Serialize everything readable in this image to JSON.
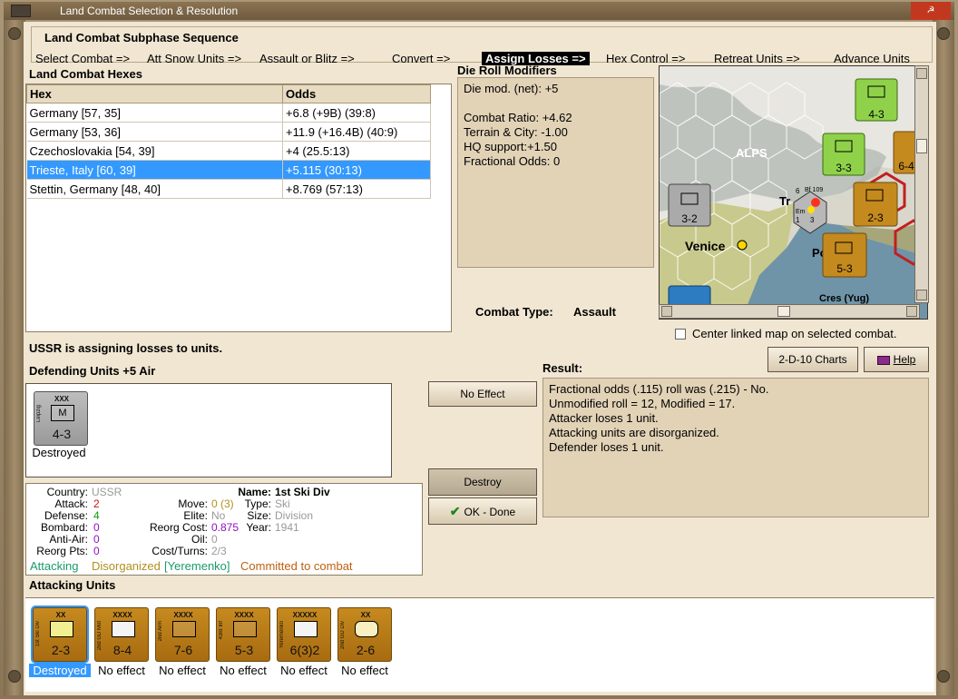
{
  "window": {
    "title": "Land Combat Selection & Resolution"
  },
  "sequence": {
    "title": "Land Combat Subphase Sequence",
    "steps": [
      "Select Combat =>",
      "Att Snow Units =>",
      "Assault or Blitz =>",
      "Convert =>",
      "Assign Losses =>",
      "Hex Control =>",
      "Retreat Units =>",
      "Advance Units"
    ],
    "active_index": 4
  },
  "hexes": {
    "title": "Land Combat Hexes",
    "columns": [
      "Hex",
      "Odds"
    ],
    "rows": [
      {
        "hex": "Germany [57, 35]",
        "odds": "+6.8 (+9B) (39:8)"
      },
      {
        "hex": "Germany [53, 36]",
        "odds": "+11.9 (+16.4B) (40:9)"
      },
      {
        "hex": "Czechoslovakia [54, 39]",
        "odds": "+4 (25.5:13)"
      },
      {
        "hex": "Trieste, Italy [60, 39]",
        "odds": "+5.115 (30:13)"
      },
      {
        "hex": "Stettin, Germany [48, 40]",
        "odds": "+8.769 (57:13)"
      }
    ],
    "selected_index": 3
  },
  "die_roll": {
    "title": "Die Roll Modifiers",
    "lines": [
      "Die mod. (net): +5",
      "",
      "Combat Ratio: +4.62",
      "Terrain & City: -1.00",
      "HQ support:+1.50",
      "Fractional Odds: 0"
    ]
  },
  "map": {
    "labels": {
      "alps": "ALPS",
      "venice": "Venice",
      "cres": "Cres (Yug)",
      "tr": "Tr",
      "po": "Po",
      "bf": "Bf 109",
      "em": "Em",
      "six": "6",
      "one": "1",
      "three": "3"
    },
    "units": [
      {
        "str": "4-3",
        "size": "XXX",
        "color": "green"
      },
      {
        "str": "3-3",
        "size": "XXX",
        "color": "green"
      },
      {
        "str": "3-2",
        "size": "XXX",
        "color": "gray"
      },
      {
        "str": "2-3",
        "size": "XX",
        "color": "orange"
      },
      {
        "str": "5-3",
        "size": "XXXX",
        "color": "orange"
      },
      {
        "str": "6-4",
        "size": "",
        "color": "orange"
      }
    ]
  },
  "combat_type": {
    "label": "Combat Type:",
    "value": "Assault"
  },
  "center_map": {
    "label": "Center linked map on selected combat.",
    "checked": false
  },
  "buttons": {
    "charts": "2-D-10 Charts",
    "help": "Help",
    "no_effect": "No Effect",
    "destroy": "Destroy",
    "ok_done": "OK - Done"
  },
  "status": "USSR is assigning losses to units.",
  "defending": {
    "title": "Defending Units +5 Air",
    "units": [
      {
        "str": "4-3",
        "size": "XXX",
        "side_text": "Leipzig",
        "label": "Destroyed"
      }
    ]
  },
  "result": {
    "title": "Result:",
    "lines": [
      "Fractional odds (.115) roll was (.215)  -  No.",
      "Unmodified roll = 12, Modified = 17.",
      "Attacker loses 1 unit.",
      "Attacking units are disorganized.",
      "Defender loses 1 unit."
    ]
  },
  "info": {
    "country_label": "Country:",
    "country": "USSR",
    "attack_label": "Attack:",
    "attack": "2",
    "defense_label": "Defense:",
    "defense": "4",
    "bombard_label": "Bombard:",
    "bombard": "0",
    "antiair_label": "Anti-Air:",
    "antiair": "0",
    "reorg_label": "Reorg Pts:",
    "reorg": "0",
    "move_label": "Move:",
    "move": "0 (3)",
    "elite_label": "Elite:",
    "elite": "No",
    "reorgcost_label": "Reorg Cost:",
    "reorgcost": "0.875",
    "oil_label": "Oil:",
    "oil": "0",
    "costturns_label": "Cost/Turns:",
    "costturns": "2/3",
    "name_label": "Name:",
    "name": "1st Ski Div",
    "type_label": "Type:",
    "type": "Ski",
    "size_label": "Size:",
    "size": "Division",
    "year_label": "Year:",
    "year": "1941",
    "tags": [
      "Attacking",
      "Disorganized",
      "[Yeremenko]",
      "Committed to combat"
    ],
    "tag_colors": [
      "#1a9a6a",
      "#b09020",
      "#1a9a6a",
      "#c06010"
    ]
  },
  "attacking": {
    "title": "Attacking Units",
    "units": [
      {
        "str": "2-3",
        "size": "XX",
        "side_text": "1st Ski Div",
        "label": "Destroyed"
      },
      {
        "str": "8-4",
        "size": "XXXX",
        "side_text": "2nd GD Mot",
        "label": "No effect"
      },
      {
        "str": "7-6",
        "size": "XXXX",
        "side_text": "2nd Arm",
        "label": "No effect"
      },
      {
        "str": "5-3",
        "size": "XXXX",
        "side_text": "43rd Inf",
        "label": "No effect"
      },
      {
        "str": "6(3)2",
        "size": "XXXXX",
        "side_text": "Yeremenko",
        "label": "No effect"
      },
      {
        "str": "2-6",
        "size": "XX",
        "side_text": "2nd GD Div",
        "label": "No effect"
      }
    ]
  },
  "colors": {
    "accent": "#3399ff",
    "counter_orange": "#b87a15",
    "counter_gray": "#aaaaaa",
    "counter_green": "#8fd24a",
    "panel": "#e2d3b7",
    "attack_red": "#d01010",
    "defense_green": "#10a010",
    "bombard_purple": "#9010c0",
    "muted": "#999999"
  }
}
